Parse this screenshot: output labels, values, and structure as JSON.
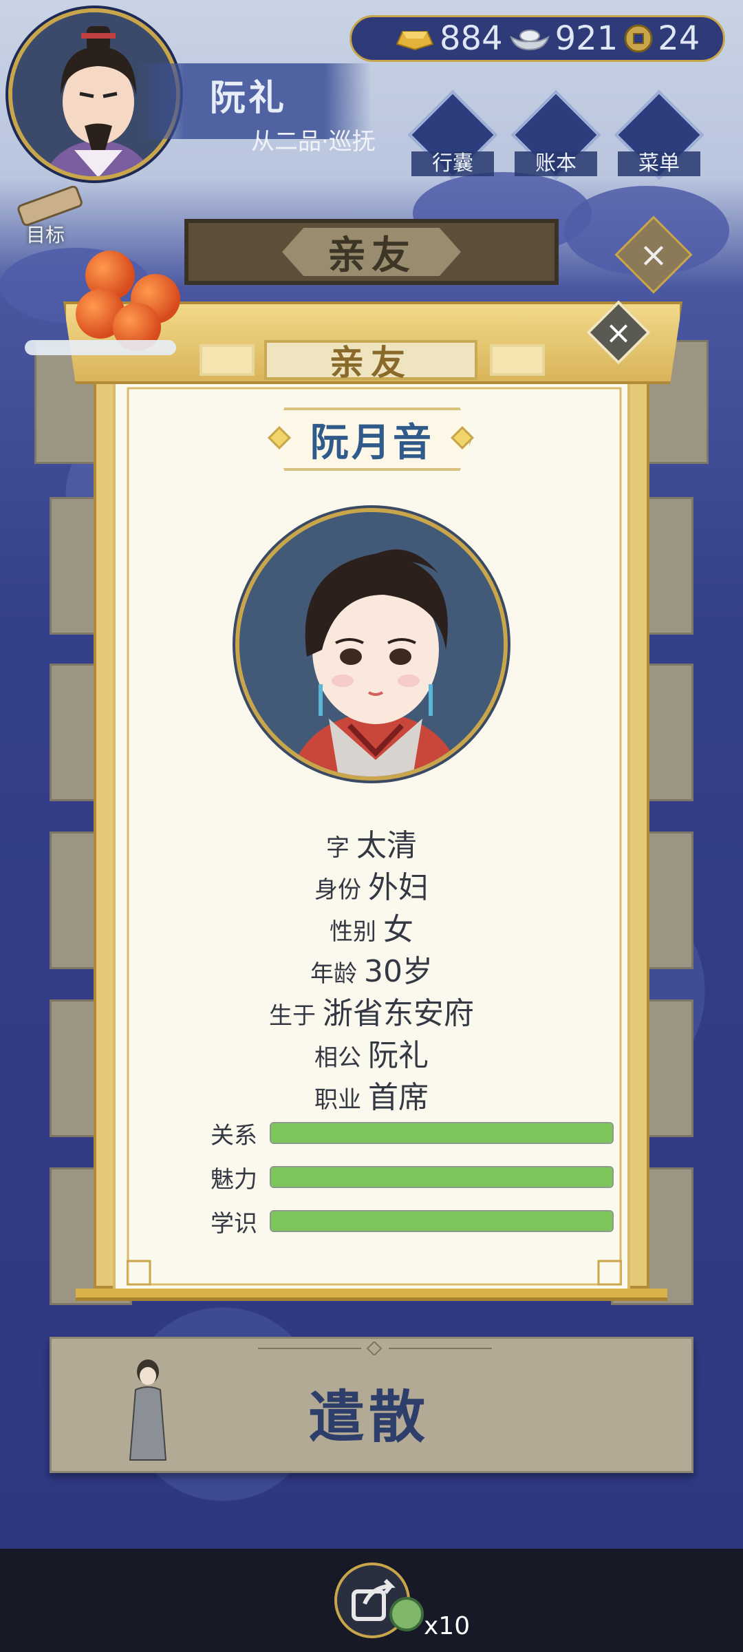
{
  "player": {
    "name": "阮礼",
    "rank": "从二品·巡抚"
  },
  "currency": {
    "gold": "884",
    "silver": "921",
    "coin": "24",
    "gold_icon": "gold-ingot-icon",
    "silver_icon": "silver-ingot-icon",
    "coin_icon": "copper-coin-icon"
  },
  "hud_buttons": [
    {
      "label": "行囊",
      "icon": "bag-icon"
    },
    {
      "label": "账本",
      "icon": "ledger-icon"
    },
    {
      "label": "菜单",
      "icon": "menu-icon"
    }
  ],
  "goal_label": "目标",
  "background_title": "亲友",
  "panel": {
    "title": "亲友",
    "character_name": "阮月音",
    "info": [
      {
        "key": "字",
        "value": "太清"
      },
      {
        "key": "身份",
        "value": "外妇"
      },
      {
        "key": "性别",
        "value": "女"
      },
      {
        "key": "年龄",
        "value": "30岁"
      },
      {
        "key": "生于",
        "value": "浙省东安府"
      },
      {
        "key": "相公",
        "value": "阮礼"
      },
      {
        "key": "职业",
        "value": "首席"
      }
    ],
    "stats": [
      {
        "key": "关系",
        "value": 1.0
      },
      {
        "key": "魅力",
        "value": 1.0
      },
      {
        "key": "学识",
        "value": 1.0
      }
    ]
  },
  "dismiss_label": "遣散",
  "share": {
    "count": "x10"
  },
  "colors": {
    "stat_fill": "#7dc45b",
    "name_color": "#2f5a8a",
    "gold_accent": "#c9a54c"
  }
}
